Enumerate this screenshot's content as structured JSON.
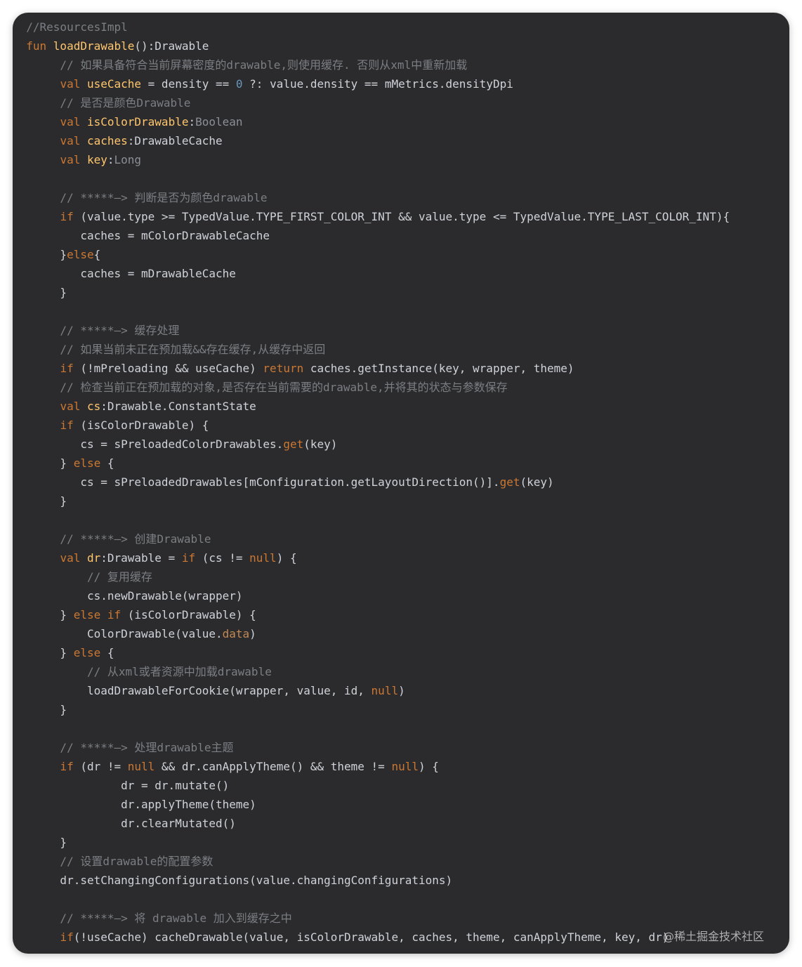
{
  "editor": {
    "language": "Kotlin",
    "theme_colors": {
      "background": "#2b2b2d",
      "keyword": "#cc7832",
      "function_name": "#ffc66d",
      "comment": "#7b7e83",
      "text": "#cfd3d9"
    },
    "lines": [
      [
        {
          "t": "//ResourcesImpl",
          "c": "cm"
        }
      ],
      [
        {
          "t": "fun ",
          "c": "kw"
        },
        {
          "t": "loadDrawable",
          "c": "fn"
        },
        {
          "t": "():Drawable",
          "c": "pl"
        }
      ],
      [
        {
          "t": "     // 如果具备符合当前屏幕密度的drawable,则使用缓存. 否则从xml中重新加载",
          "c": "cm"
        }
      ],
      [
        {
          "t": "     ",
          "c": "pl"
        },
        {
          "t": "val ",
          "c": "kw"
        },
        {
          "t": "useCache",
          "c": "var"
        },
        {
          "t": " = density == ",
          "c": "pl"
        },
        {
          "t": "0",
          "c": "num"
        },
        {
          "t": " ?: value.density == mMetrics.densityDpi",
          "c": "pl"
        }
      ],
      [
        {
          "t": "     // 是否是颜色Drawable",
          "c": "cm"
        }
      ],
      [
        {
          "t": "     ",
          "c": "pl"
        },
        {
          "t": "val ",
          "c": "kw"
        },
        {
          "t": "isColorDrawable",
          "c": "var"
        },
        {
          "t": ":",
          "c": "pl"
        },
        {
          "t": "Boolean",
          "c": "tydim"
        }
      ],
      [
        {
          "t": "     ",
          "c": "pl"
        },
        {
          "t": "val ",
          "c": "kw"
        },
        {
          "t": "caches",
          "c": "var"
        },
        {
          "t": ":DrawableCache",
          "c": "pl"
        }
      ],
      [
        {
          "t": "     ",
          "c": "pl"
        },
        {
          "t": "val ",
          "c": "kw"
        },
        {
          "t": "key",
          "c": "var"
        },
        {
          "t": ":",
          "c": "pl"
        },
        {
          "t": "Long",
          "c": "tydim"
        }
      ],
      [
        {
          "t": "",
          "c": "pl"
        }
      ],
      [
        {
          "t": "     // *****—> 判断是否为颜色drawable",
          "c": "cm"
        }
      ],
      [
        {
          "t": "     ",
          "c": "pl"
        },
        {
          "t": "if",
          "c": "kw"
        },
        {
          "t": " (value.type >= TypedValue.TYPE_FIRST_COLOR_INT && value.type <= TypedValue.TYPE_LAST_COLOR_INT){",
          "c": "pl"
        }
      ],
      [
        {
          "t": "        caches = mColorDrawableCache",
          "c": "pl"
        }
      ],
      [
        {
          "t": "     }",
          "c": "pl"
        },
        {
          "t": "else",
          "c": "kw"
        },
        {
          "t": "{",
          "c": "pl"
        }
      ],
      [
        {
          "t": "        caches = mDrawableCache",
          "c": "pl"
        }
      ],
      [
        {
          "t": "     }",
          "c": "pl"
        }
      ],
      [
        {
          "t": "",
          "c": "pl"
        }
      ],
      [
        {
          "t": "     // *****—> 缓存处理",
          "c": "cm"
        }
      ],
      [
        {
          "t": "     // 如果当前未正在预加载&&存在缓存,从缓存中返回",
          "c": "cm"
        }
      ],
      [
        {
          "t": "     ",
          "c": "pl"
        },
        {
          "t": "if",
          "c": "kw"
        },
        {
          "t": " (!mPreloading && useCache) ",
          "c": "pl"
        },
        {
          "t": "return",
          "c": "kw"
        },
        {
          "t": " caches.getInstance(key, wrapper, theme)",
          "c": "pl"
        }
      ],
      [
        {
          "t": "     // 检查当前正在预加载的对象,是否存在当前需要的drawable,并将其的状态与参数保存",
          "c": "cm"
        }
      ],
      [
        {
          "t": "     ",
          "c": "pl"
        },
        {
          "t": "val ",
          "c": "kw"
        },
        {
          "t": "cs",
          "c": "var"
        },
        {
          "t": ":Drawable.ConstantState",
          "c": "pl"
        }
      ],
      [
        {
          "t": "     ",
          "c": "pl"
        },
        {
          "t": "if",
          "c": "kw"
        },
        {
          "t": " (isColorDrawable) {",
          "c": "pl"
        }
      ],
      [
        {
          "t": "        cs = sPreloadedColorDrawables.",
          "c": "pl"
        },
        {
          "t": "get",
          "c": "kw"
        },
        {
          "t": "(key)",
          "c": "pl"
        }
      ],
      [
        {
          "t": "     } ",
          "c": "pl"
        },
        {
          "t": "else",
          "c": "kw"
        },
        {
          "t": " {",
          "c": "pl"
        }
      ],
      [
        {
          "t": "        cs = sPreloadedDrawables[mConfiguration.getLayoutDirection()].",
          "c": "pl"
        },
        {
          "t": "get",
          "c": "kw"
        },
        {
          "t": "(key)",
          "c": "pl"
        }
      ],
      [
        {
          "t": "     }",
          "c": "pl"
        }
      ],
      [
        {
          "t": "",
          "c": "pl"
        }
      ],
      [
        {
          "t": "     // *****—> 创建Drawable",
          "c": "cm"
        }
      ],
      [
        {
          "t": "     ",
          "c": "pl"
        },
        {
          "t": "val ",
          "c": "kw"
        },
        {
          "t": "dr",
          "c": "var"
        },
        {
          "t": ":Drawable = ",
          "c": "pl"
        },
        {
          "t": "if",
          "c": "kw"
        },
        {
          "t": " (cs != ",
          "c": "pl"
        },
        {
          "t": "null",
          "c": "kw"
        },
        {
          "t": ") {",
          "c": "pl"
        }
      ],
      [
        {
          "t": "         // 复用缓存",
          "c": "cm"
        }
      ],
      [
        {
          "t": "         cs.newDrawable(wrapper)",
          "c": "pl"
        }
      ],
      [
        {
          "t": "     } ",
          "c": "pl"
        },
        {
          "t": "else if",
          "c": "kw"
        },
        {
          "t": " (isColorDrawable) {",
          "c": "pl"
        }
      ],
      [
        {
          "t": "         ColorDrawable(value.",
          "c": "pl"
        },
        {
          "t": "data",
          "c": "prop"
        },
        {
          "t": ")",
          "c": "pl"
        }
      ],
      [
        {
          "t": "     } ",
          "c": "pl"
        },
        {
          "t": "else",
          "c": "kw"
        },
        {
          "t": " {",
          "c": "pl"
        }
      ],
      [
        {
          "t": "         // 从xml或者资源中加载drawable",
          "c": "cm"
        }
      ],
      [
        {
          "t": "         loadDrawableForCookie(wrapper, value, id, ",
          "c": "pl"
        },
        {
          "t": "null",
          "c": "kw"
        },
        {
          "t": ")",
          "c": "pl"
        }
      ],
      [
        {
          "t": "     }",
          "c": "pl"
        }
      ],
      [
        {
          "t": "",
          "c": "pl"
        }
      ],
      [
        {
          "t": "     // *****—> 处理drawable主题",
          "c": "cm"
        }
      ],
      [
        {
          "t": "     ",
          "c": "pl"
        },
        {
          "t": "if",
          "c": "kw"
        },
        {
          "t": " (dr != ",
          "c": "pl"
        },
        {
          "t": "null",
          "c": "kw"
        },
        {
          "t": " && dr.canApplyTheme() && theme != ",
          "c": "pl"
        },
        {
          "t": "null",
          "c": "kw"
        },
        {
          "t": ") {",
          "c": "pl"
        }
      ],
      [
        {
          "t": "              dr = dr.mutate()",
          "c": "pl"
        }
      ],
      [
        {
          "t": "              dr.applyTheme(theme)",
          "c": "pl"
        }
      ],
      [
        {
          "t": "              dr.clearMutated()",
          "c": "pl"
        }
      ],
      [
        {
          "t": "     }",
          "c": "pl"
        }
      ],
      [
        {
          "t": "     // 设置drawable的配置参数",
          "c": "cm"
        }
      ],
      [
        {
          "t": "     dr.setChangingConfigurations(value.changingConfigurations)",
          "c": "pl"
        }
      ],
      [
        {
          "t": "",
          "c": "pl"
        }
      ],
      [
        {
          "t": "     // *****—> 将 drawable 加入到缓存之中",
          "c": "cm"
        }
      ],
      [
        {
          "t": "     ",
          "c": "pl"
        },
        {
          "t": "if",
          "c": "kw"
        },
        {
          "t": "(!useCache) cacheDrawable(value, isColorDrawable, caches, theme, canApplyTheme, key, dr)",
          "c": "pl"
        }
      ]
    ]
  },
  "watermark": "@稀土掘金技术社区"
}
